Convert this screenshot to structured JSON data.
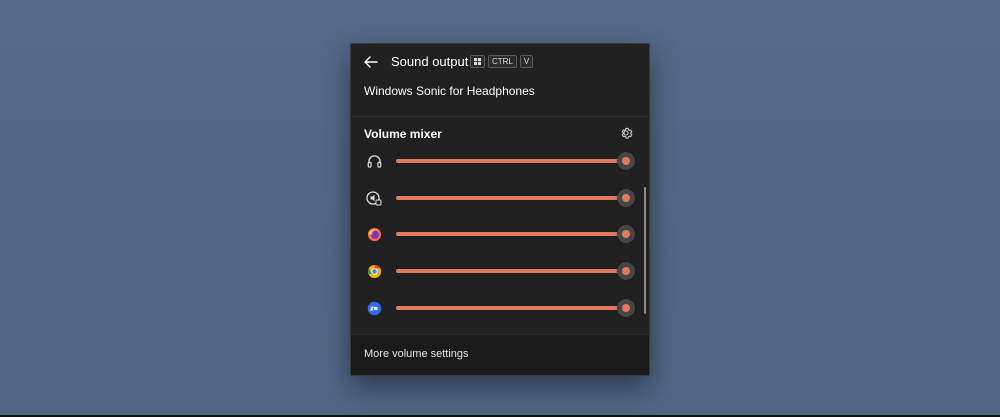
{
  "header": {
    "title": "Sound output",
    "shortcut": {
      "win_key": "windows-logo-icon",
      "ctrl": "CTRL",
      "v": "V"
    }
  },
  "device": {
    "name": "Windows Sonic for Headphones"
  },
  "mixer": {
    "title": "Volume mixer",
    "settings_icon": "gear-icon",
    "rows": [
      {
        "icon": "headphones-icon",
        "volume_percent": 100
      },
      {
        "icon": "system-sounds-icon",
        "volume_percent": 100
      },
      {
        "icon": "firefox-icon",
        "volume_percent": 100
      },
      {
        "icon": "chrome-canary-icon",
        "volume_percent": 100
      },
      {
        "icon": "zoom-icon",
        "volume_percent": 100
      }
    ]
  },
  "footer": {
    "more_label": "More volume settings"
  },
  "colors": {
    "accent": "#e17a5f",
    "panel": "#202020",
    "footer": "#1a1a1a",
    "desktop": "#546a8a"
  }
}
